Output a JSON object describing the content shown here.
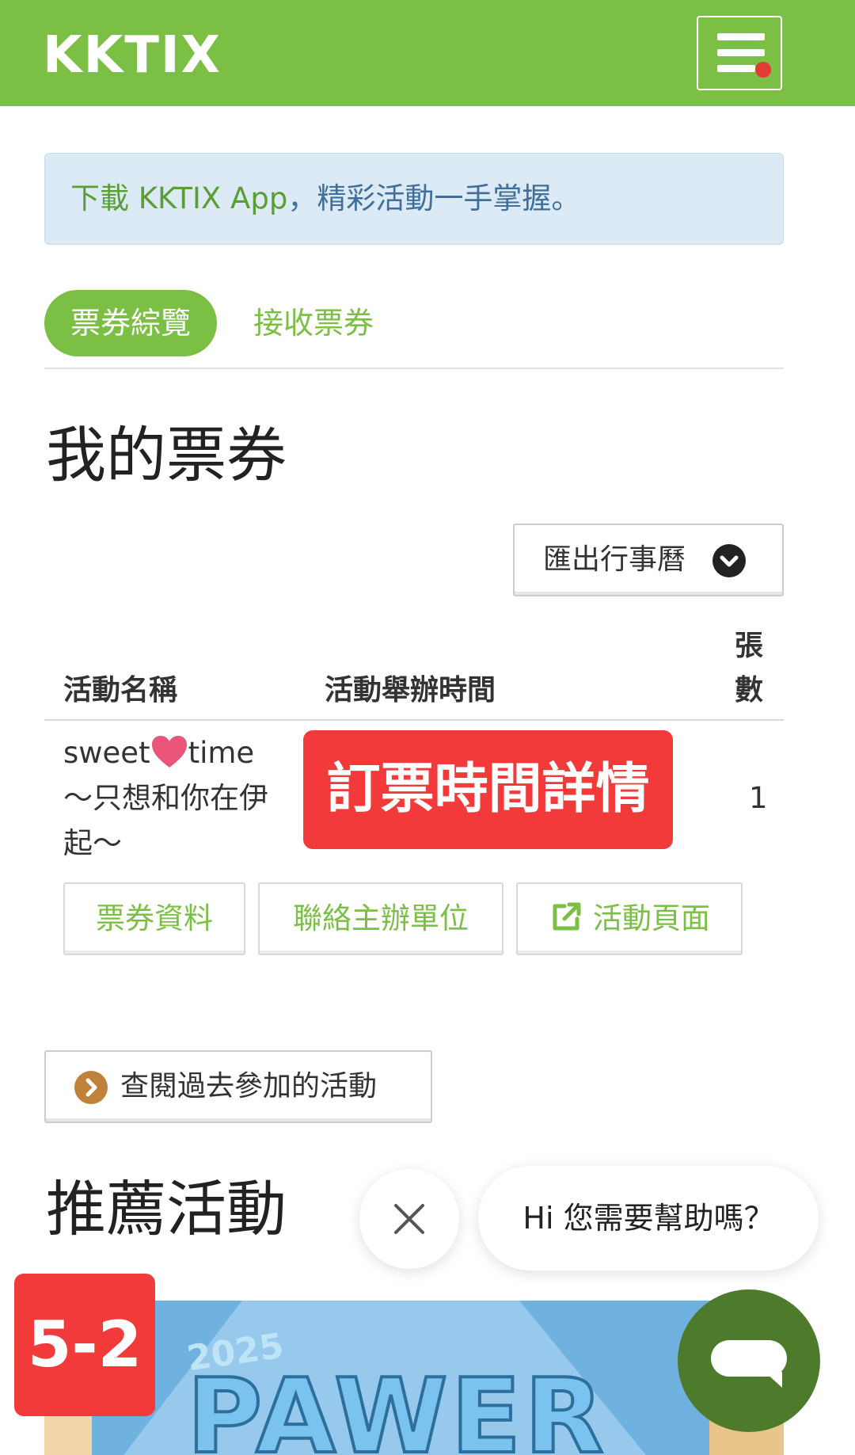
{
  "header": {
    "logo": "KKTIX",
    "menu_icon": "hamburger-menu-icon",
    "notification_dot_color": "#e53935"
  },
  "app_banner": {
    "highlight": "下載 KKTIX App",
    "text": "，精彩活動一手掌握。"
  },
  "tabs": [
    {
      "label": "票券綜覽",
      "active": true
    },
    {
      "label": "接收票券",
      "active": false
    }
  ],
  "page_title": "我的票券",
  "export_button": {
    "label": "匯出行事曆",
    "icon": "chevron-down-circle-icon"
  },
  "table": {
    "headers": {
      "name": "活動名稱",
      "time": "活動舉辦時間",
      "count_line1": "張",
      "count_line2": "數"
    },
    "rows": [
      {
        "name_part1": "sweet",
        "name_part2": "time",
        "name_line2": "～只想和你在伊",
        "name_line3": "起～",
        "count": "1"
      }
    ],
    "actions": {
      "ticket_info": "票券資料",
      "contact": "聯絡主辦單位",
      "event_page": "活動頁面",
      "event_page_icon": "external-link-icon"
    }
  },
  "overlay_label": "訂票時間詳情",
  "past_events_button": {
    "label": "查閱過去參加的活動",
    "icon": "chevron-right-circle-icon"
  },
  "recommend_title": "推薦活動",
  "promo_banner": {
    "text_year": "2025",
    "text_main": "PAWER"
  },
  "chat": {
    "bubble": "Hi 您需要幫助嗎？",
    "close_icon": "close-icon",
    "fab_icon": "chat-icon"
  },
  "corner_badge": "5-2",
  "colors": {
    "brand_green": "#7bbf45",
    "banner_bg": "#dceaf5",
    "overlay_red": "#f23a3a",
    "chat_fab": "#4e7b2b"
  }
}
